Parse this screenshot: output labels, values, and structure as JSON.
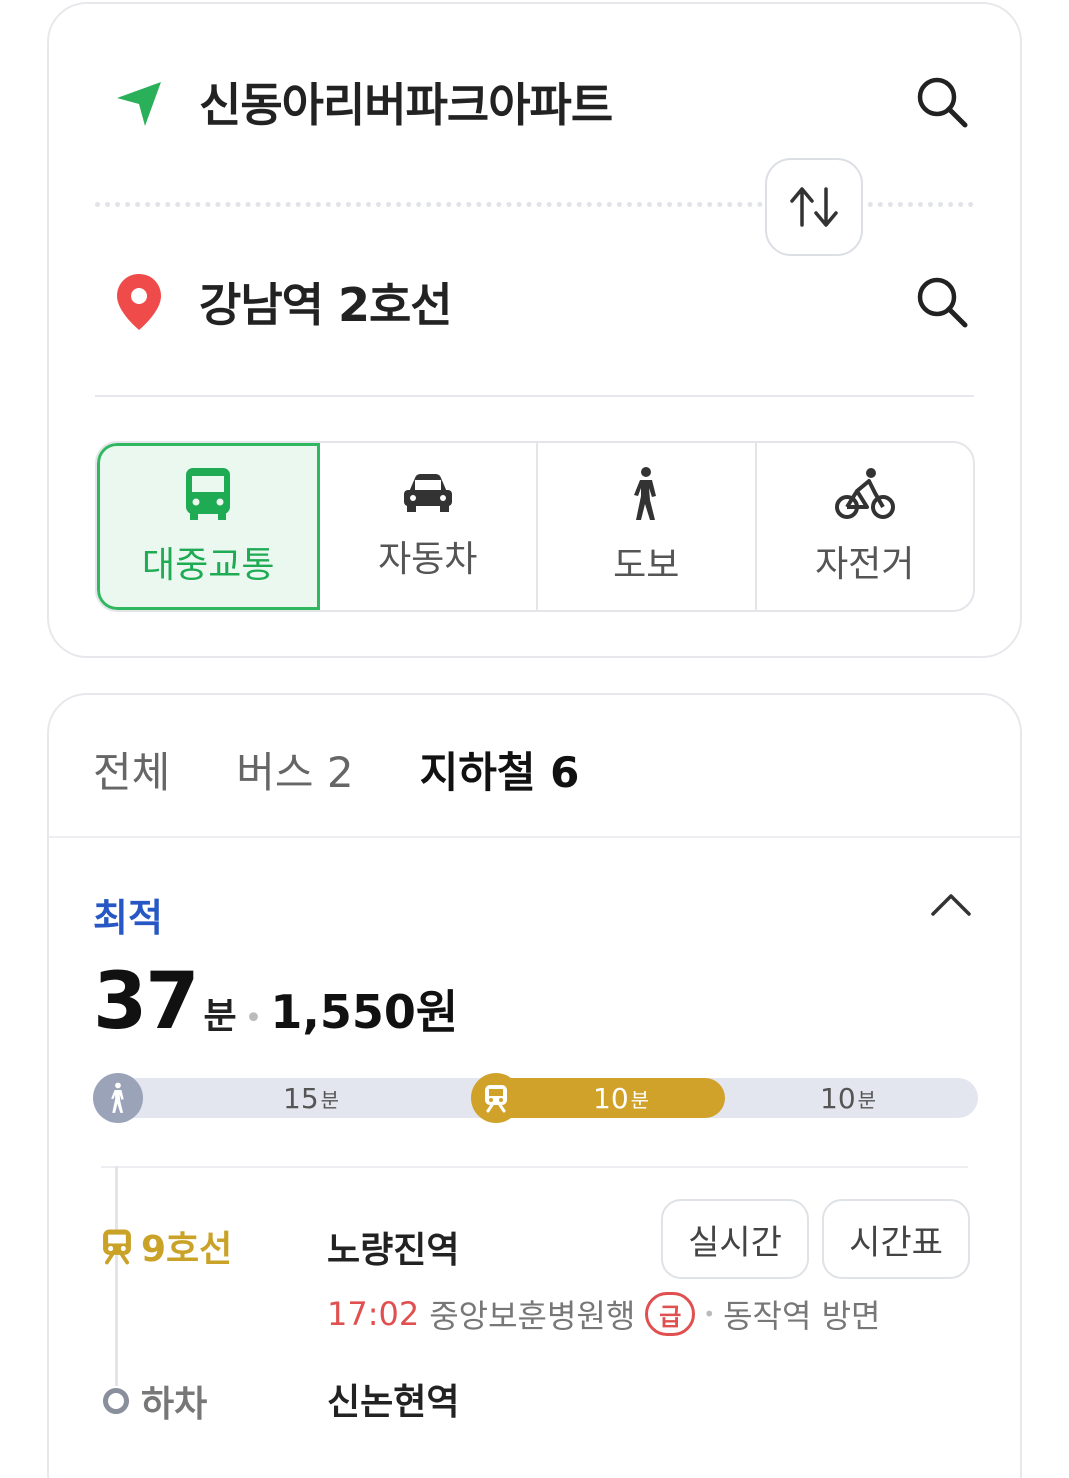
{
  "origin": {
    "name": "신동아리버파크아파트"
  },
  "destination": {
    "name": "강남역 2호선"
  },
  "modes": [
    {
      "label": "대중교통",
      "icon": "bus-icon",
      "active": true
    },
    {
      "label": "자동차",
      "icon": "car-icon",
      "active": false
    },
    {
      "label": "도보",
      "icon": "walk-icon",
      "active": false
    },
    {
      "label": "자전거",
      "icon": "bicycle-icon",
      "active": false
    }
  ],
  "tabs": [
    {
      "label": "전체",
      "active": false
    },
    {
      "label": "버스 2",
      "active": false
    },
    {
      "label": "지하철 6",
      "active": true
    }
  ],
  "route": {
    "badge": "최적",
    "minutes": "37",
    "minutes_unit": "분",
    "fare": "1,550원",
    "segments": [
      {
        "type": "walk",
        "minutes": "15",
        "unit": "분"
      },
      {
        "type": "subway",
        "minutes": "10",
        "unit": "분"
      },
      {
        "type": "walk",
        "minutes": "10",
        "unit": "분"
      }
    ],
    "leg": {
      "line": "9호선",
      "board_station": "노량진역",
      "realtime_label": "실시간",
      "timetable_label": "시간표",
      "arrival_time": "17:02",
      "destination": "중앙보훈병원행",
      "express_label": "급",
      "direction": "동작역 방면",
      "alight_label": "하차",
      "alight_station": "신논현역"
    }
  },
  "colors": {
    "accent_green": "#30b860",
    "subway_line9": "#d0a22a",
    "best_blue": "#2657c4",
    "alert_red": "#e05050"
  }
}
